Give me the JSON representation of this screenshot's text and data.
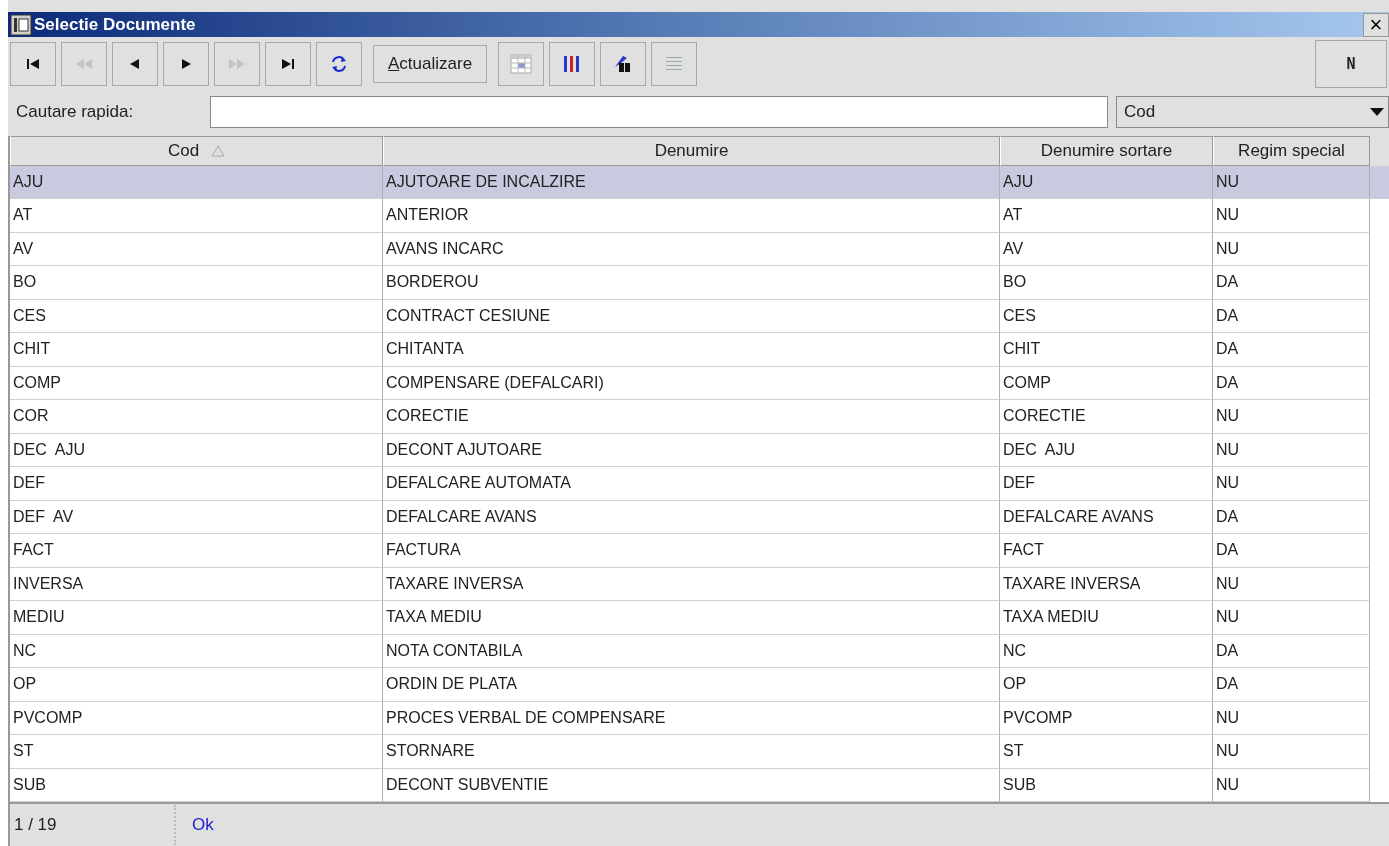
{
  "window": {
    "title": "Selectie Documente",
    "close": "×"
  },
  "toolbar": {
    "buttons": [
      {
        "kind": "first",
        "disabled": false
      },
      {
        "kind": "prev-page",
        "disabled": true
      },
      {
        "kind": "prev",
        "disabled": false
      },
      {
        "kind": "next",
        "disabled": false
      },
      {
        "kind": "next-page",
        "disabled": true
      },
      {
        "kind": "last",
        "disabled": false
      },
      {
        "kind": "refresh",
        "disabled": false
      },
      {
        "kind": "text",
        "label_parts": [
          {
            "text": "A",
            "underlined": true
          },
          {
            "text": "ctualizare",
            "underlined": false
          }
        ],
        "disabled": false
      },
      {
        "kind": "grid",
        "disabled": false
      },
      {
        "kind": "sort",
        "disabled": false
      },
      {
        "kind": "filter",
        "disabled": false
      },
      {
        "kind": "lines",
        "disabled": false
      }
    ],
    "right_button": "N"
  },
  "search": {
    "label": "Cautare rapida:",
    "field": "Cod"
  },
  "table": {
    "columns": [
      {
        "label": "Cod",
        "sorted": true
      },
      {
        "label": "Denumire",
        "sorted": false
      },
      {
        "label": "Denumire sortare",
        "sorted": false
      },
      {
        "label": "Regim special",
        "sorted": false
      }
    ],
    "rows": [
      {
        "cells": [
          "AJU",
          "AJUTOARE DE INCALZIRE",
          "AJU",
          "NU"
        ],
        "selected": true
      },
      {
        "cells": [
          "AT",
          "ANTERIOR",
          "AT",
          "NU"
        ],
        "selected": false
      },
      {
        "cells": [
          "AV",
          "AVANS INCARC",
          "AV",
          "NU"
        ],
        "selected": false
      },
      {
        "cells": [
          "BO",
          "BORDEROU",
          "BO",
          "DA"
        ],
        "selected": false
      },
      {
        "cells": [
          "CES",
          "CONTRACT CESIUNE",
          "CES",
          "DA"
        ],
        "selected": false
      },
      {
        "cells": [
          "CHIT",
          "CHITANTA",
          "CHIT",
          "DA"
        ],
        "selected": false
      },
      {
        "cells": [
          "COMP",
          "COMPENSARE (DEFALCARI)",
          "COMP",
          "DA"
        ],
        "selected": false
      },
      {
        "cells": [
          "COR",
          "CORECTIE",
          "CORECTIE",
          "NU"
        ],
        "selected": false
      },
      {
        "cells": [
          "DEC  AJU",
          "DECONT AJUTOARE",
          "DEC  AJU",
          "NU"
        ],
        "selected": false
      },
      {
        "cells": [
          "DEF",
          "DEFALCARE AUTOMATA",
          "DEF",
          "NU"
        ],
        "selected": false
      },
      {
        "cells": [
          "DEF  AV",
          "DEFALCARE AVANS",
          "DEFALCARE AVANS",
          "DA"
        ],
        "selected": false
      },
      {
        "cells": [
          "FACT",
          "FACTURA",
          "FACT",
          "DA"
        ],
        "selected": false
      },
      {
        "cells": [
          "INVERSA",
          "TAXARE INVERSA",
          "TAXARE INVERSA",
          "NU"
        ],
        "selected": false
      },
      {
        "cells": [
          "MEDIU",
          "TAXA MEDIU",
          "TAXA MEDIU",
          "NU"
        ],
        "selected": false
      },
      {
        "cells": [
          "NC",
          "NOTA CONTABILA",
          "NC",
          "DA"
        ],
        "selected": false
      },
      {
        "cells": [
          "OP",
          "ORDIN DE PLATA",
          "OP",
          "DA"
        ],
        "selected": false
      },
      {
        "cells": [
          "PVCOMP",
          "PROCES VERBAL DE COMPENSARE",
          "PVCOMP",
          "NU"
        ],
        "selected": false
      },
      {
        "cells": [
          "ST",
          "STORNARE",
          "ST",
          "NU"
        ],
        "selected": false
      },
      {
        "cells": [
          "SUB",
          "DECONT SUBVENTIE",
          "SUB",
          "NU"
        ],
        "selected": false
      }
    ]
  },
  "status_bar": {
    "position": "1 / 19",
    "message": "Ok"
  }
}
